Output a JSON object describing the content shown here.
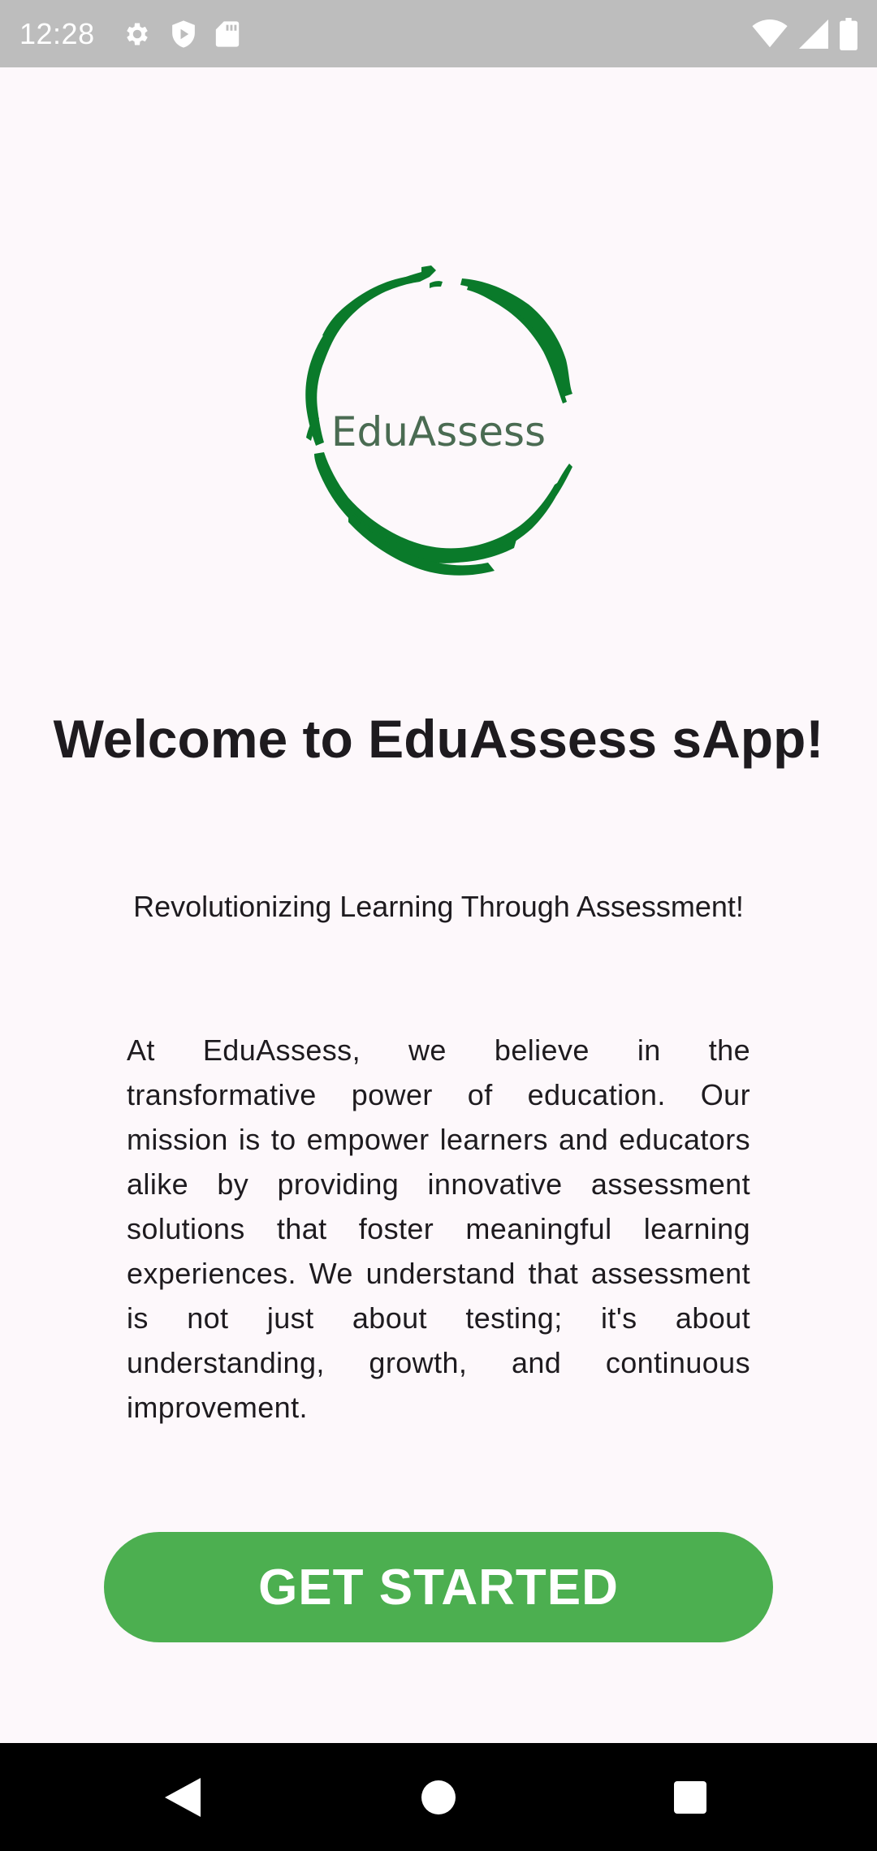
{
  "status_bar": {
    "time": "12:28",
    "left_icons": [
      "gear-icon",
      "shield-play-icon",
      "sd-card-icon"
    ],
    "right_icons": [
      "wifi-icon",
      "cellular-signal-icon",
      "battery-icon"
    ]
  },
  "logo": {
    "text": "EduAssess",
    "ring_color": "#0a7a2a",
    "text_color": "#4a6b52"
  },
  "welcome": {
    "title": "Welcome to EduAssess sApp!"
  },
  "tagline": "Revolutionizing Learning Through Assessment!",
  "mission": "At EduAssess, we believe in the transformative power of education. Our mission is to empower learners and educators alike by providing innovative assessment solutions that foster meaningful learning experiences. We understand that assessment is not just about testing; it's about understanding, growth, and continuous improvement.",
  "cta": {
    "label": "GET STARTED",
    "color": "#4caf50"
  },
  "nav_bar": {
    "icons": [
      "back-icon",
      "home-icon",
      "recents-icon"
    ]
  }
}
